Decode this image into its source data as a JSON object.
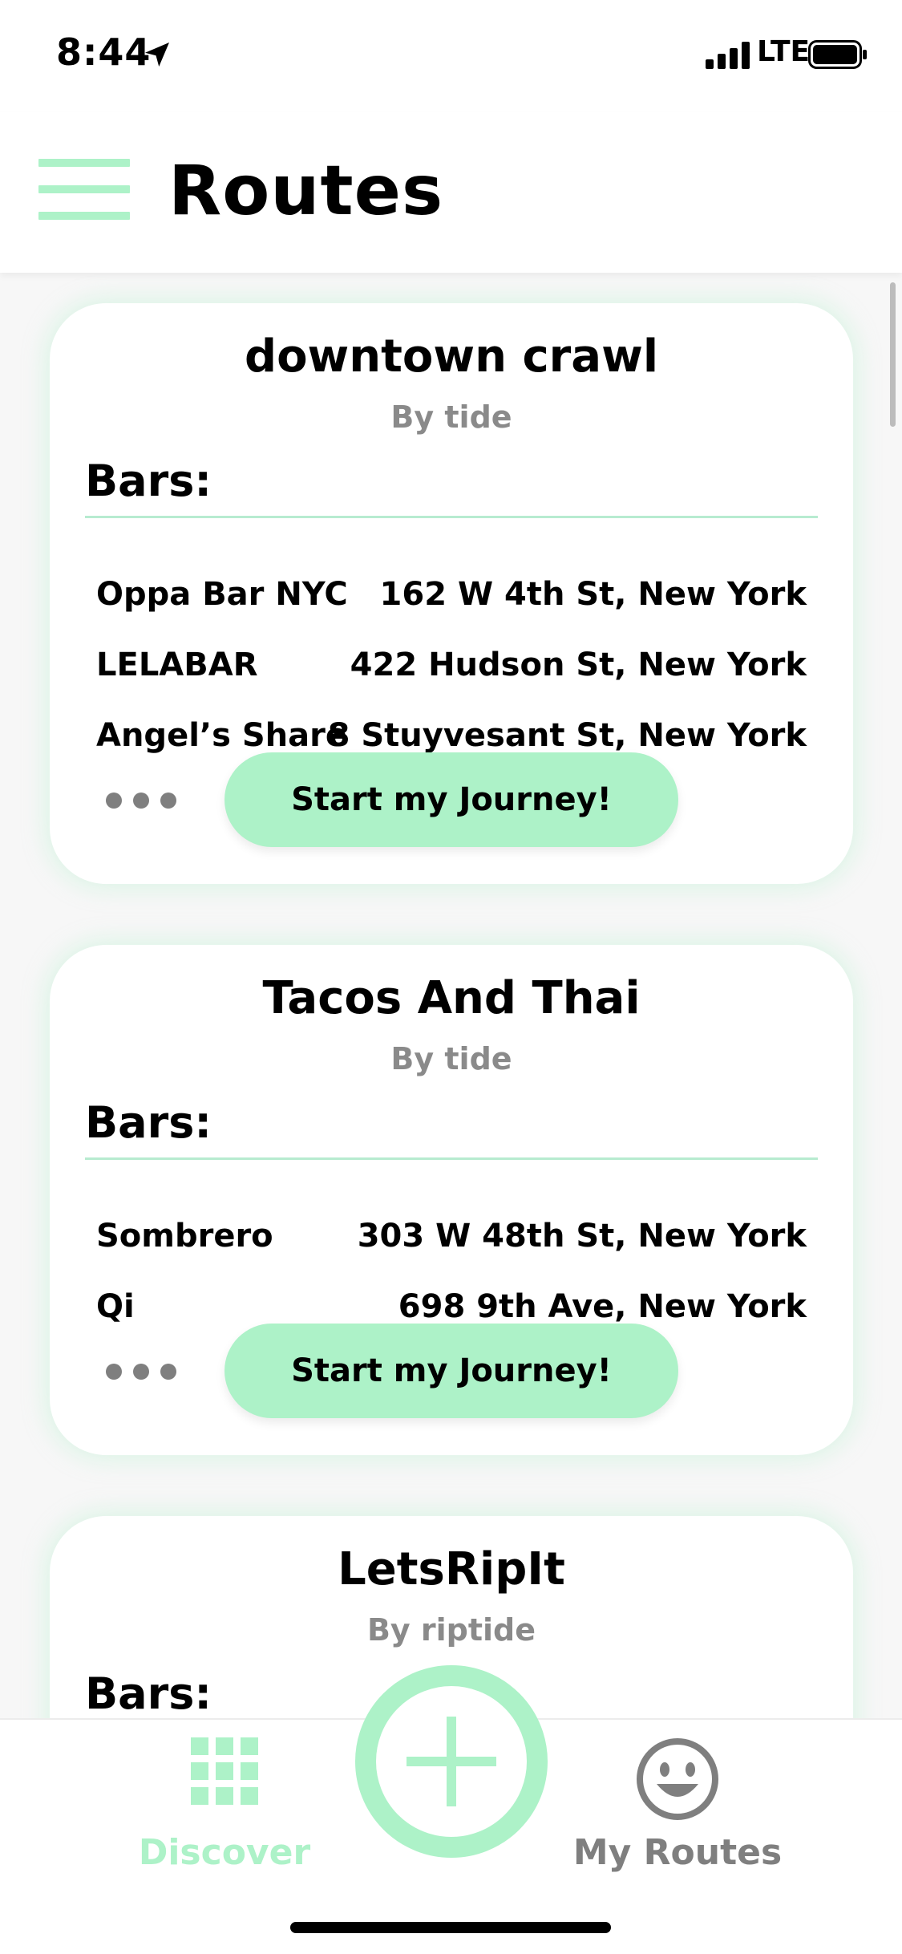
{
  "status": {
    "time": "8:44",
    "network": "LTE",
    "icons": [
      "location-arrow-icon",
      "signal-bars-icon",
      "battery-icon"
    ]
  },
  "header": {
    "title": "Routes",
    "menu_icon": "hamburger-menu-icon"
  },
  "labels": {
    "bars": "Bars:",
    "start_button": "Start my Journey!",
    "more_icon": "more-dots-icon"
  },
  "routes": [
    {
      "name": "downtown crawl",
      "author": "By tide",
      "bars": [
        {
          "name": "Oppa Bar NYC",
          "address": "162 W 4th St, New York"
        },
        {
          "name": "LELABAR",
          "address": "422 Hudson St, New York"
        },
        {
          "name": "Angel’s Share",
          "address": "8 Stuyvesant St, New York"
        }
      ]
    },
    {
      "name": "Tacos And Thai",
      "author": "By tide",
      "bars": [
        {
          "name": "Sombrero",
          "address": "303 W 48th St, New York"
        },
        {
          "name": "Qi",
          "address": "698 9th Ave, New York"
        }
      ]
    },
    {
      "name": "LetsRipIt",
      "author": "By riptide",
      "bars": []
    }
  ],
  "tabs": {
    "discover": "Discover",
    "my_routes": "My Routes",
    "discover_icon": "grid-icon",
    "add_icon": "plus-icon",
    "my_routes_icon": "smiley-face-icon"
  },
  "colors": {
    "accent": "#adf2c8",
    "muted": "#8a8a8a",
    "text": "#000000"
  }
}
